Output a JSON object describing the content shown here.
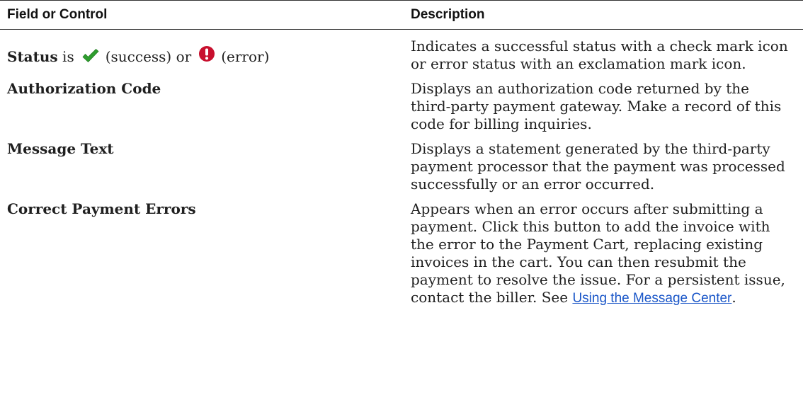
{
  "table": {
    "headers": [
      "Field or Control",
      "Description"
    ],
    "status_row": {
      "label_bold": "Status",
      "is_text": " is",
      "success_text": "(success) or",
      "error_text": "(error)",
      "success_icon": "check-mark-icon",
      "error_icon": "exclamation-mark-icon",
      "success_color": "#2e9e2e",
      "error_color": "#c8102e",
      "description": "Indicates a successful status with a check mark icon or error status with an exclamation mark icon."
    },
    "rows": [
      {
        "field": "Authorization Code",
        "description": "Displays an authorization code returned by the third-party payment gateway. Make a record of this code for billing inquiries."
      },
      {
        "field": "Message Text",
        "description": "Displays a statement generated by the third-party payment processor that the payment was processed successfully or an error occurred."
      }
    ],
    "last_row": {
      "field": "Correct Payment Errors",
      "description": "Appears when an error occurs after submitting a payment. Click this button to add the invoice with the error to the Payment Cart, replacing existing invoices in the cart. You can then resubmit the payment to resolve the issue. For a persistent issue, contact the biller. See ",
      "link_text": "Using the Message Center",
      "link_color": "#1a56c8",
      "after_link": "."
    }
  }
}
